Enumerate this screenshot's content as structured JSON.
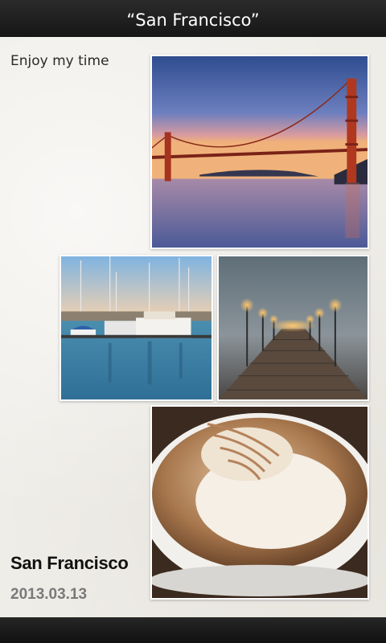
{
  "header": {
    "title": "“San Francisco”"
  },
  "album": {
    "caption": "Enjoy my time",
    "title": "San Francisco",
    "date": "2013.03.13"
  },
  "photos": [
    {
      "name": "golden-gate-bridge-photo"
    },
    {
      "name": "marina-boats-photo"
    },
    {
      "name": "foggy-pier-photo"
    },
    {
      "name": "latte-art-photo"
    }
  ],
  "colors": {
    "bar": "#1c1c1c",
    "paper": "#efede8",
    "date": "#7a7a7a"
  }
}
